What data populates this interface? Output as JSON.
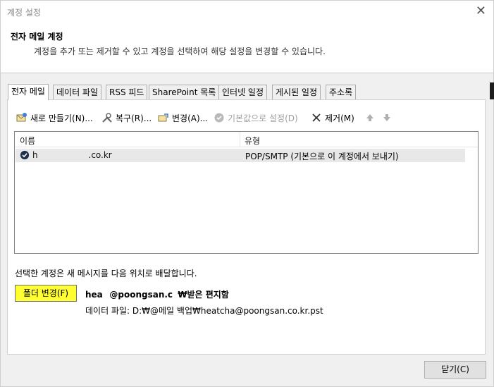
{
  "window": {
    "title": "계정 설정"
  },
  "header": {
    "title": "전자 메일 계정",
    "description": "계정을 추가 또는 제거할 수 있고 계정을 선택하여 해당 설정을 변경할 수 있습니다."
  },
  "tabs": [
    {
      "label": "전자 메일",
      "active": true
    },
    {
      "label": "데이터 파일",
      "active": false
    },
    {
      "label": "RSS 피드",
      "active": false
    },
    {
      "label": "SharePoint 목록",
      "active": false
    },
    {
      "label": "인터넷 일정",
      "active": false
    },
    {
      "label": "게시된 일정",
      "active": false
    },
    {
      "label": "주소록",
      "active": false
    }
  ],
  "toolbar": {
    "new_label": "새로 만들기(N)...",
    "repair_label": "복구(R)...",
    "change_label": "변경(A)...",
    "default_label": "기본값으로 설정(D)",
    "remove_label": "제거(M)"
  },
  "account_list": {
    "columns": [
      "이름",
      "유형"
    ],
    "rows": [
      {
        "name": "h                              .co.kr",
        "type": "POP/SMTP (기본으로 이 계정에서 보내기)"
      }
    ]
  },
  "delivery": {
    "text": "선택한 계정은 새 메시지를 다음 위치로 배달합니다.",
    "folder_button": "폴더 변경(F)",
    "folder_path": "hea    @poongsan.c   ₩받은 편지함",
    "data_file": "데이터 파일: D:₩@메일 백업₩heatcha@poongsan.co.kr.pst"
  },
  "footer": {
    "close_label": "닫기(C)"
  },
  "colors": {
    "highlight": "#ffff33",
    "selected_row": "#e8e8e8"
  }
}
